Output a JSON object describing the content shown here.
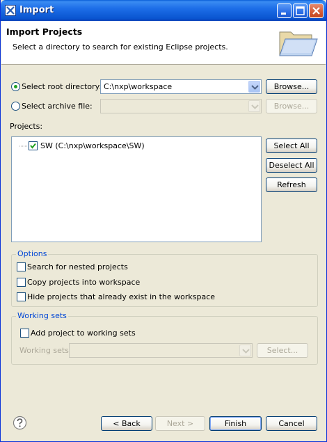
{
  "window": {
    "title": "Import",
    "header_title": "Import Projects",
    "header_desc": "Select a directory to search for existing Eclipse projects."
  },
  "source": {
    "root_radio_label": "Select root directory:",
    "root_value": "C:\\nxp\\workspace",
    "root_browse": "Browse...",
    "archive_radio_label": "Select archive file:",
    "archive_value": "",
    "archive_browse": "Browse...",
    "selected": "root"
  },
  "projects": {
    "label": "Projects:",
    "items": [
      {
        "label": "SW (C:\\nxp\\workspace\\SW)",
        "checked": true
      }
    ],
    "select_all": "Select All",
    "deselect_all": "Deselect All",
    "refresh": "Refresh"
  },
  "options": {
    "title": "Options",
    "nested": "Search for nested projects",
    "copy": "Copy projects into workspace",
    "hide": "Hide projects that already exist in the workspace"
  },
  "working_sets": {
    "title": "Working sets",
    "add_label": "Add project to working sets",
    "sets_label": "Working sets:",
    "sets_value": "",
    "select_button": "Select..."
  },
  "footer": {
    "help_icon": "help-icon",
    "back": "< Back",
    "next": "Next >",
    "finish": "Finish",
    "cancel": "Cancel"
  },
  "colors": {
    "titlebar": "#0a55d0",
    "group_title": "#0046d5",
    "radio_dot": "#21a121",
    "check_mark": "#21a121"
  }
}
